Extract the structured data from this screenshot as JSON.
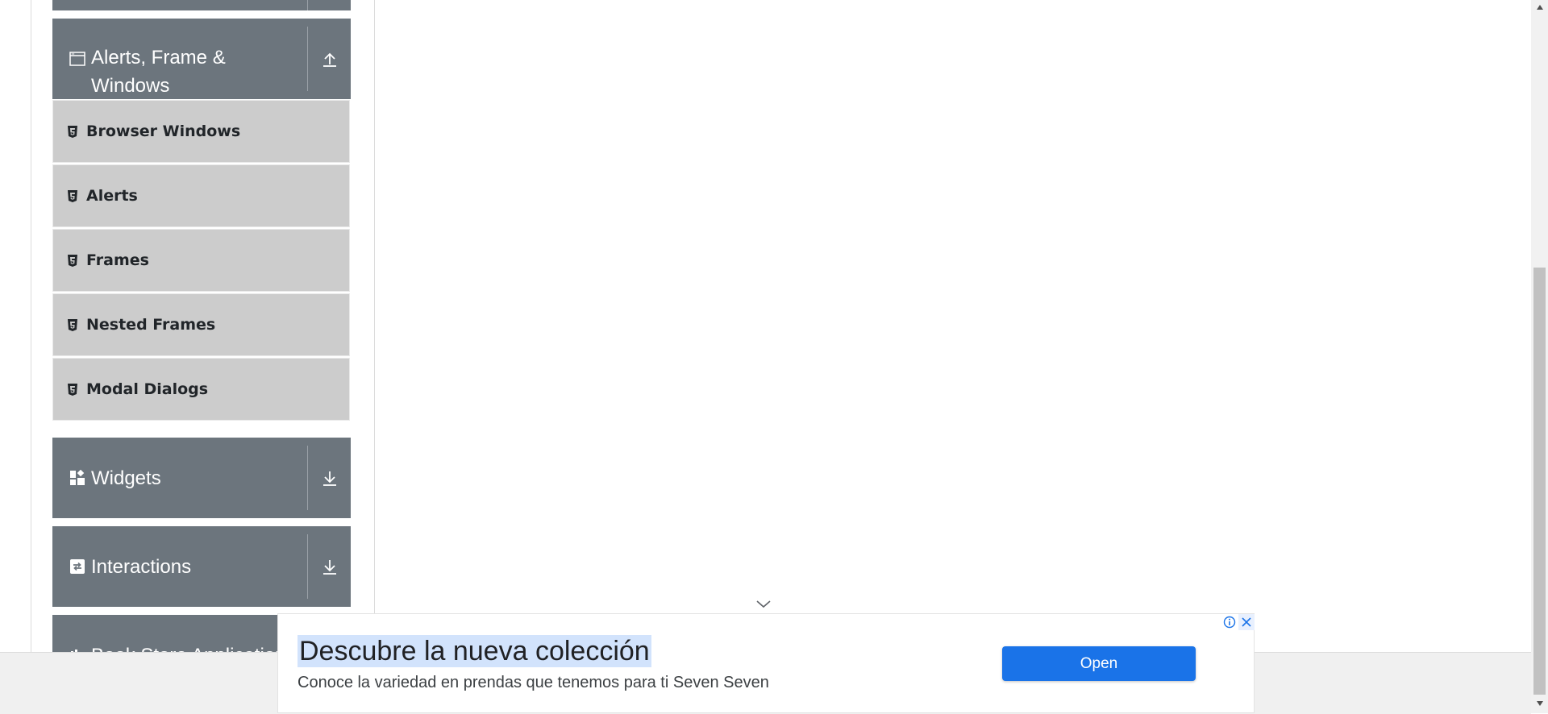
{
  "sidebar": {
    "alerts_group": {
      "title_line1": "Alerts, Frame &",
      "title_line2": "Windows",
      "icon": "window-icon",
      "toggle_icon": "collapse-up-icon"
    },
    "alerts_items": [
      {
        "label": "Browser Windows",
        "icon": "html5-icon"
      },
      {
        "label": "Alerts",
        "icon": "html5-icon"
      },
      {
        "label": "Frames",
        "icon": "html5-icon"
      },
      {
        "label": "Nested Frames",
        "icon": "html5-icon"
      },
      {
        "label": "Modal Dialogs",
        "icon": "html5-icon"
      }
    ],
    "widgets_group": {
      "title": "Widgets",
      "icon": "widgets-icon",
      "toggle_icon": "expand-down-icon"
    },
    "interactions_group": {
      "title": "Interactions",
      "icon": "interactions-icon",
      "toggle_icon": "expand-down-icon"
    },
    "bookstore_group": {
      "title": "Book Store Application",
      "icon": "book-store-icon"
    }
  },
  "ad": {
    "title": "Descubre la nueva colección",
    "description": "Conoce la variedad en prendas que tenemos para ti Seven Seven",
    "button_label": "Open",
    "info_icon": "info-icon",
    "close_icon": "close-icon",
    "collapse_icon": "chevron-down-icon"
  },
  "colors": {
    "group_header_bg": "#6c757d",
    "sub_item_bg": "#cccccc",
    "ad_button_bg": "#1a73e8"
  }
}
